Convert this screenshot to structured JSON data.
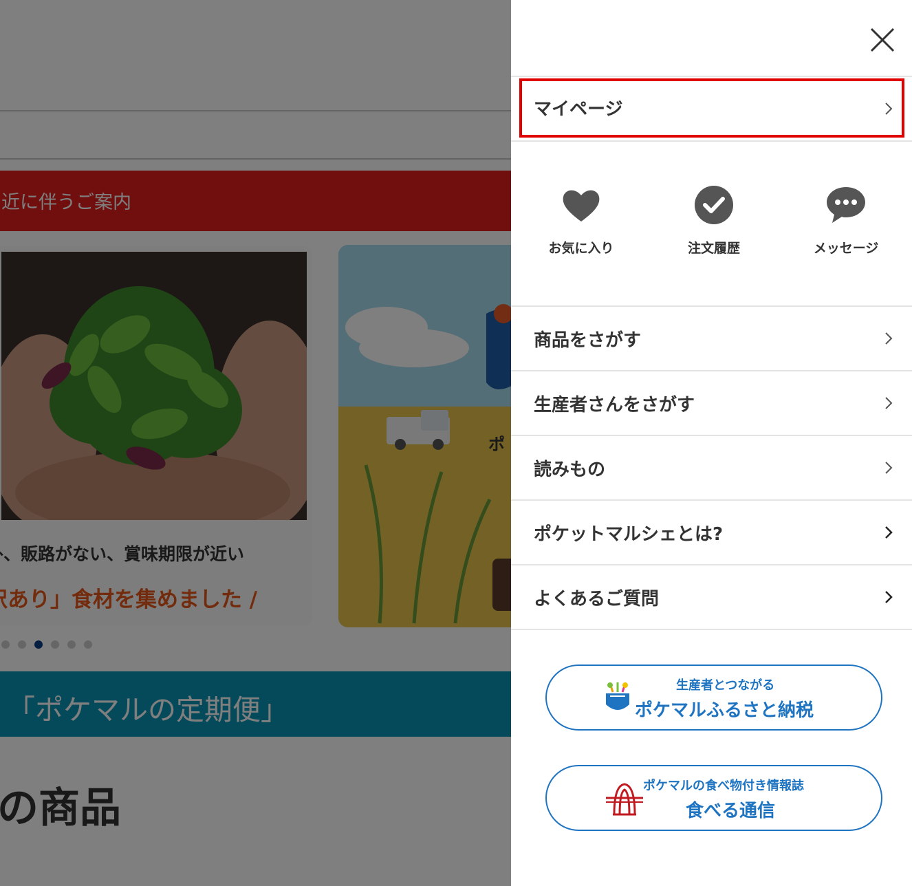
{
  "background": {
    "banner_text": "近に伴うご案内",
    "card1_line1": "外、販路がない、賞味期限が近い",
    "card1_line2": "訳あり」食材を集めました /",
    "card2_text": "ポ",
    "teal_banner_text": "「ポケマルの定期便」",
    "section_title": "の商品",
    "colors": {
      "red_banner": "#e21f1f",
      "teal_banner": "#0a95b5",
      "active_dot": "#0a3f86"
    },
    "carousel": {
      "dot_count": 6,
      "active_index": 2
    }
  },
  "drawer": {
    "close_icon": "close-icon",
    "mypage_label": "マイページ",
    "quick_links": [
      {
        "label": "お気に入り",
        "icon": "heart-icon"
      },
      {
        "label": "注文履歴",
        "icon": "check-circle-icon"
      },
      {
        "label": "メッセージ",
        "icon": "chat-bubble-icon"
      }
    ],
    "menu_items": [
      {
        "label": "商品をさがす"
      },
      {
        "label": "生産者さんをさがす"
      },
      {
        "label": "読みもの"
      },
      {
        "label": "ポケットマルシェとは?"
      },
      {
        "label": "よくあるご質問"
      }
    ],
    "furusato": {
      "small": "生産者とつながる",
      "big": "ポケマルふるさと納税"
    },
    "taberu": {
      "small": "ポケマルの食べ物付き情報誌",
      "big": "食べる通信"
    },
    "colors": {
      "accent": "#1f74c2",
      "highlight": "#e00000"
    }
  }
}
